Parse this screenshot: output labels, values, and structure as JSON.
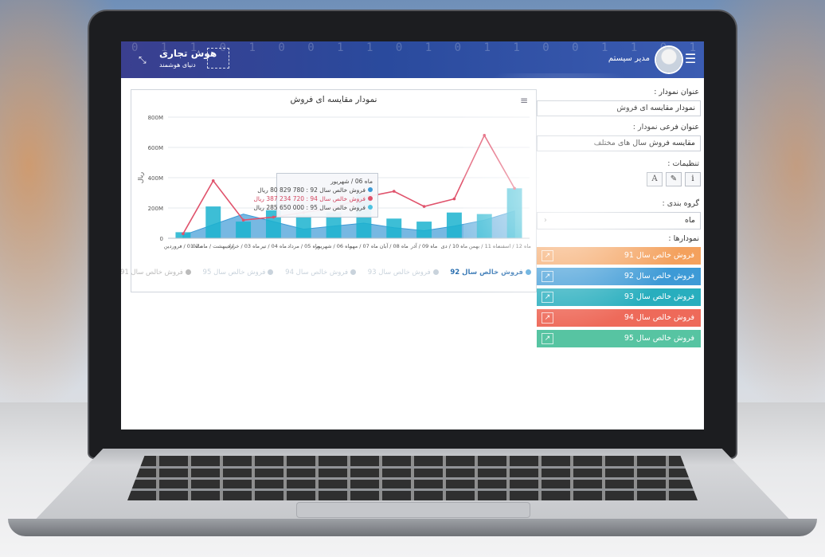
{
  "header": {
    "username": "مدیر سیستم",
    "logo_name": "هوش تجاری",
    "logo_tagline": "دنیای هوشمند",
    "matrix_text": "1 0 1 1 0 0 1 1 0 1 0 1 1 0 0 1 0 1 1 0 1 0 0 1 1 0 1",
    "menu_icon": "hamburger-icon",
    "collapse_icon": "collapse-arrows-icon"
  },
  "settings": {
    "chart_title_label": "عنوان نمودار :",
    "chart_title_value": "نمودار مقایسه ای فروش",
    "chart_subtitle_label": "عنوان فرعی نمودار :",
    "chart_subtitle_value": "مقایسه فروش سال های مختلف",
    "settings_label": "تنظیمات :",
    "tool_buttons": [
      "i",
      "✎",
      "A"
    ],
    "group_by_label": "گروه بندی :",
    "group_by_value": "ماه",
    "charts_label": "نمودارها :",
    "series_items": [
      {
        "label": "فروش خالص سال 91",
        "color": "#f4a15d"
      },
      {
        "label": "فروش خالص سال 92",
        "color": "#3d9ad6"
      },
      {
        "label": "فروش خالص سال 93",
        "color": "#28aebe"
      },
      {
        "label": "فروش خالص سال 94",
        "color": "#ee6a5a"
      },
      {
        "label": "فروش خالص سال 95",
        "color": "#57c4a2"
      }
    ]
  },
  "tooltip": {
    "header": "ماه 06 / شهریور",
    "rows": [
      {
        "text": "فروش خالص سال 92 : 780 829 80 ریال",
        "color": "#3d9ad6"
      },
      {
        "text": "فروش خالص سال 94 : 720 234 387 ریال",
        "color": "#e0536c"
      },
      {
        "text": "فروش خالص سال 95 : 000 650 285 ریال",
        "color": "#4cc3e0"
      }
    ]
  },
  "chart_data": {
    "type": "bar",
    "title": "نمودار مقایسه ای فروش",
    "ylabel": "ریال",
    "ylim": [
      0,
      800
    ],
    "y_ticks": [
      "0",
      "200M",
      "400M",
      "600M",
      "800M"
    ],
    "categories": [
      "ماه 01 / فروردین",
      "اردیبهشت / ماه 02",
      "ماه 03 / خرداد",
      "ماه 04 / تیر",
      "ماه 05 / مرداد",
      "ماه 06 / شهریور",
      "ماه 07 / مهر",
      "ماه 08 / آبان",
      "ماه 09 / آذر",
      "ماه 10 / دی",
      "ماه 11 / بهمن",
      "ماه 12 / اسفند"
    ],
    "series": [
      {
        "name": "فروش خالص سال 92",
        "kind": "area",
        "color": "#3d9ad6",
        "values": [
          20,
          90,
          160,
          110,
          60,
          80,
          100,
          70,
          50,
          80,
          120,
          180
        ]
      },
      {
        "name": "فروش خالص سال 95",
        "kind": "bar",
        "color": "#1bb3cf",
        "values": [
          40,
          210,
          110,
          185,
          155,
          170,
          290,
          130,
          110,
          170,
          160,
          330
        ]
      },
      {
        "name": "فروش خالص سال 94",
        "kind": "line",
        "color": "#e0536c",
        "values": [
          30,
          380,
          120,
          140,
          170,
          200,
          270,
          310,
          210,
          260,
          680,
          330
        ]
      }
    ],
    "legend": [
      {
        "name": "فروش خالص سال 91",
        "color": "#bbbbbb",
        "active": false
      },
      {
        "name": "فروش خالص سال 92",
        "color": "#3d9ad6",
        "active": true
      },
      {
        "name": "فروش خالص سال 93",
        "color": "#c9d3dc",
        "active": false
      },
      {
        "name": "فروش خالص سال 94",
        "color": "#c9d3dc",
        "active": false
      },
      {
        "name": "فروش خالص سال 95",
        "color": "#c9d3dc",
        "active": false
      }
    ],
    "grid": true,
    "legend_position": "bottom"
  }
}
